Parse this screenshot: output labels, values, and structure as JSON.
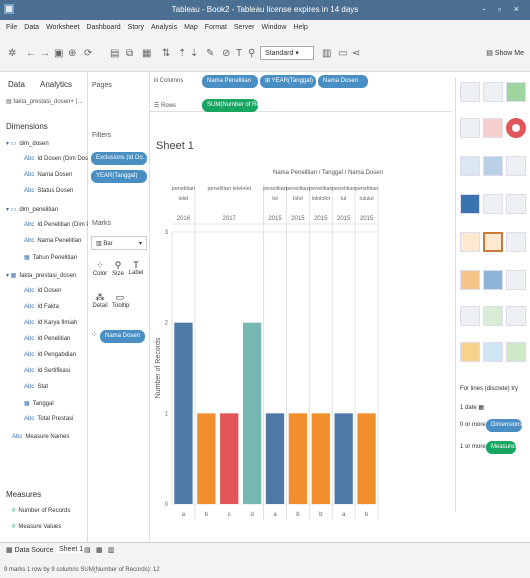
{
  "window": {
    "title": "Tableau - Book2 - Tableau license expires in 14 days",
    "controls": "- ▫ ×"
  },
  "menu": [
    "File",
    "Data",
    "Worksheet",
    "Dashboard",
    "Story",
    "Analysis",
    "Map",
    "Format",
    "Server",
    "Window",
    "Help"
  ],
  "toolbar": {
    "format_select": "Standard",
    "show_me": "Show Me"
  },
  "left_pane": {
    "tab_data": "Data",
    "tab_analytics": "Analytics",
    "datasource": "fakta_prestasi_dosen+ (...",
    "dimensions_label": "Dimensions",
    "folders": [
      {
        "name": "dim_dosen",
        "items": [
          "Id Dosen (Dim Dosen)",
          "Nama Dosen",
          "Status Dosen"
        ]
      },
      {
        "name": "dim_penelitian",
        "items": [
          "Id Penelitian (Dim Pene...",
          "Nama Penelitian",
          "Tahun Penelitian"
        ]
      },
      {
        "name": "fakta_prestasi_dosen",
        "items": [
          "Id Dosen",
          "Id Fakta",
          "Id Karya Ilmiah",
          "Id Penelitian",
          "Id Pengabdian",
          "Id Sertifikasi",
          "Stat",
          "Tanggal",
          "Total Prestasi"
        ]
      }
    ],
    "measure_names": "Measure Names",
    "measures_label": "Measures",
    "measures": [
      "Number of Records",
      "Measure Values"
    ]
  },
  "pages_col": {
    "pages": "Pages",
    "filters": "Filters",
    "filter_pills": [
      "Exclusions (Id Do.. ⊕",
      "YEAR(Tanggal)"
    ],
    "marks": "Marks",
    "mark_type": "Bar",
    "mark_buttons": [
      "Color",
      "Size",
      "Label",
      "Detail",
      "Tooltip"
    ],
    "color_pill": "Nama Dosen"
  },
  "shelves": {
    "columns_label": "iii Columns",
    "rows_label": "☰ Rows",
    "columns_pills": [
      "Nama Penelitian",
      "⊞ YEAR(Tanggal)",
      "Nama Dosen"
    ],
    "rows_pills": [
      "SUM(Number of Rec..."
    ]
  },
  "sheet": {
    "title": "Sheet 1",
    "header_title": "Nama Penelitian / Tanggal / Nama Dosen",
    "ylabel": "Number of Records",
    "col_groups": [
      {
        "name": "penelitian\nlelel",
        "year": "2016"
      },
      {
        "name": "penelitian lelelelel",
        "year": "2017"
      },
      {
        "name": "penelitian\nlol",
        "year": "2015"
      },
      {
        "name": "penelitian\nlolol",
        "year": "2015"
      },
      {
        "name": "penelitian\nlolololol",
        "year": "2015"
      },
      {
        "name": "penelitian\nlul",
        "year": "2015"
      },
      {
        "name": "penelitian\nlululul",
        "year": "2015"
      }
    ]
  },
  "chart_data": {
    "type": "bar",
    "categories": [
      "a",
      "b",
      "c",
      "d",
      "a",
      "b",
      "b",
      "a",
      "b"
    ],
    "values": [
      2,
      1,
      1,
      2,
      1,
      1,
      1,
      1,
      1
    ],
    "colors": [
      "#4e79a7",
      "#f28e2b",
      "#e15759",
      "#76b7b2",
      "#4e79a7",
      "#f28e2b",
      "#f28e2b",
      "#4e79a7",
      "#f28e2b"
    ],
    "group_of_bar": [
      0,
      1,
      1,
      1,
      2,
      3,
      4,
      5,
      6
    ],
    "title": "Nama Penelitian / Tanggal / Nama Dosen",
    "ylabel": "Number of Records",
    "ylim": [
      0,
      3
    ],
    "yticks": [
      0,
      1,
      2,
      3
    ]
  },
  "show_me": {
    "for_lines": "For lines (discrete) try",
    "date": "1 date",
    "dimensions_hint": "0 or more",
    "dimensions_pill": "Dimensions",
    "measures_hint": "1 or more",
    "measures_pill": "Measures"
  },
  "status": {
    "data_source_tab": "Data Source",
    "sheet_tab": "Sheet 1",
    "summary": "9 marks  1 row by 9 columns  SUM(Number of Records): 12"
  }
}
